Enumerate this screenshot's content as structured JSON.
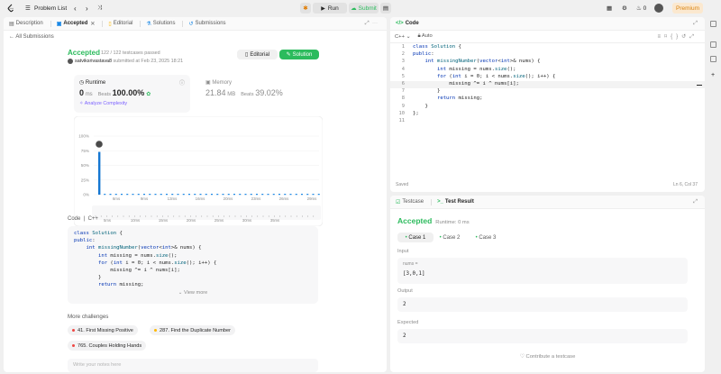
{
  "topbar": {
    "problem_list": "Problem List",
    "run": "Run",
    "submit": "Submit",
    "fire_count": "0",
    "premium": "Premium"
  },
  "left_tabs": [
    "Description",
    "Accepted",
    "Editorial",
    "Solutions",
    "Submissions"
  ],
  "submission": {
    "back": "All Submissions",
    "status": "Accepted",
    "passed": "122 / 122 testcases passed",
    "user": "satviksrivastava8",
    "submitted": "submitted at Feb 23, 2025 18:21",
    "editorial_btn": "Editorial",
    "solution_btn": "Solution",
    "runtime_label": "Runtime",
    "runtime_value": "0",
    "runtime_unit": "ms",
    "beats_label": "Beats",
    "runtime_beats": "100.00%",
    "analyze": "Analyze Complexity",
    "memory_label": "Memory",
    "memory_value": "21.84",
    "memory_unit": "MB",
    "memory_beats": "39.02%"
  },
  "chart_data": {
    "type": "bar",
    "ylabels": [
      "100%",
      "75%",
      "50%",
      "25%",
      "0%"
    ],
    "xlabels": [
      "6ms",
      "9ms",
      "13ms",
      "16ms",
      "20ms",
      "23ms",
      "26ms",
      "29ms"
    ],
    "mini_xlabels": [
      "5ms",
      "10ms",
      "15ms",
      "20ms",
      "25ms",
      "30ms",
      "35ms"
    ],
    "values": [
      73,
      1.5,
      1.5,
      1.5,
      1.5,
      1.5,
      1.5,
      1.5,
      1.5,
      1.5,
      1.5,
      1.5,
      1.5,
      1.5,
      1.5,
      1.5,
      1.5,
      1.5,
      1.5,
      1.5,
      1.5,
      1.5,
      1.5,
      1.5,
      1.5,
      1.5,
      1.5,
      1.5,
      1.5,
      1.5,
      1.5,
      1.5,
      1.5,
      1.5,
      1.5,
      1.5,
      1.5,
      1.5,
      1.5,
      1.5
    ],
    "ylim": [
      0,
      100
    ],
    "highlight_color": "#1677d2",
    "bar_color": "#1a88e6"
  },
  "code_section": {
    "label": "Code",
    "lang": "C++",
    "view_more": "View more",
    "lines": [
      "class Solution {",
      "public:",
      "    int missingNumber(vector<int>& nums) {",
      "        int missing = nums.size();",
      "        for (int i = 0; i < nums.size(); i++) {",
      "            missing ^= i ^ nums[i];",
      "        }",
      "        return missing;"
    ]
  },
  "more_challenges": {
    "title": "More challenges",
    "items": [
      {
        "label": "41. First Missing Positive",
        "color": "#ef4743"
      },
      {
        "label": "287. Find the Duplicate Number",
        "color": "#ffb800"
      },
      {
        "label": "765. Couples Holding Hands",
        "color": "#ef4743"
      }
    ],
    "notes_placeholder": "Write your notes here"
  },
  "editor": {
    "title": "Code",
    "lang": "C++",
    "auto": "Auto",
    "saved": "Saved",
    "position": "Ln 6, Col 37",
    "line_numbers": [
      "1",
      "2",
      "3",
      "4",
      "5",
      "6",
      "7",
      "8",
      "9",
      "10",
      "11"
    ],
    "lines": [
      "class Solution {",
      "public:",
      "    int missingNumber(vector<int>& nums) {",
      "        int missing = nums.size();",
      "        for (int i = 0; i < nums.size(); i++) {",
      "            missing ^= i ^ nums[i];",
      "        }",
      "        return missing;",
      "    }",
      "};",
      ""
    ]
  },
  "result_panel": {
    "tab_testcase": "Testcase",
    "tab_result": "Test Result",
    "status": "Accepted",
    "runtime": "Runtime: 0 ms",
    "cases": [
      "Case 1",
      "Case 2",
      "Case 3"
    ],
    "input_label": "Input",
    "input_var": "nums =",
    "input_value": "[3,0,1]",
    "output_label": "Output",
    "output_value": "2",
    "expected_label": "Expected",
    "expected_value": "2",
    "contribute": "Contribute a testcase"
  }
}
